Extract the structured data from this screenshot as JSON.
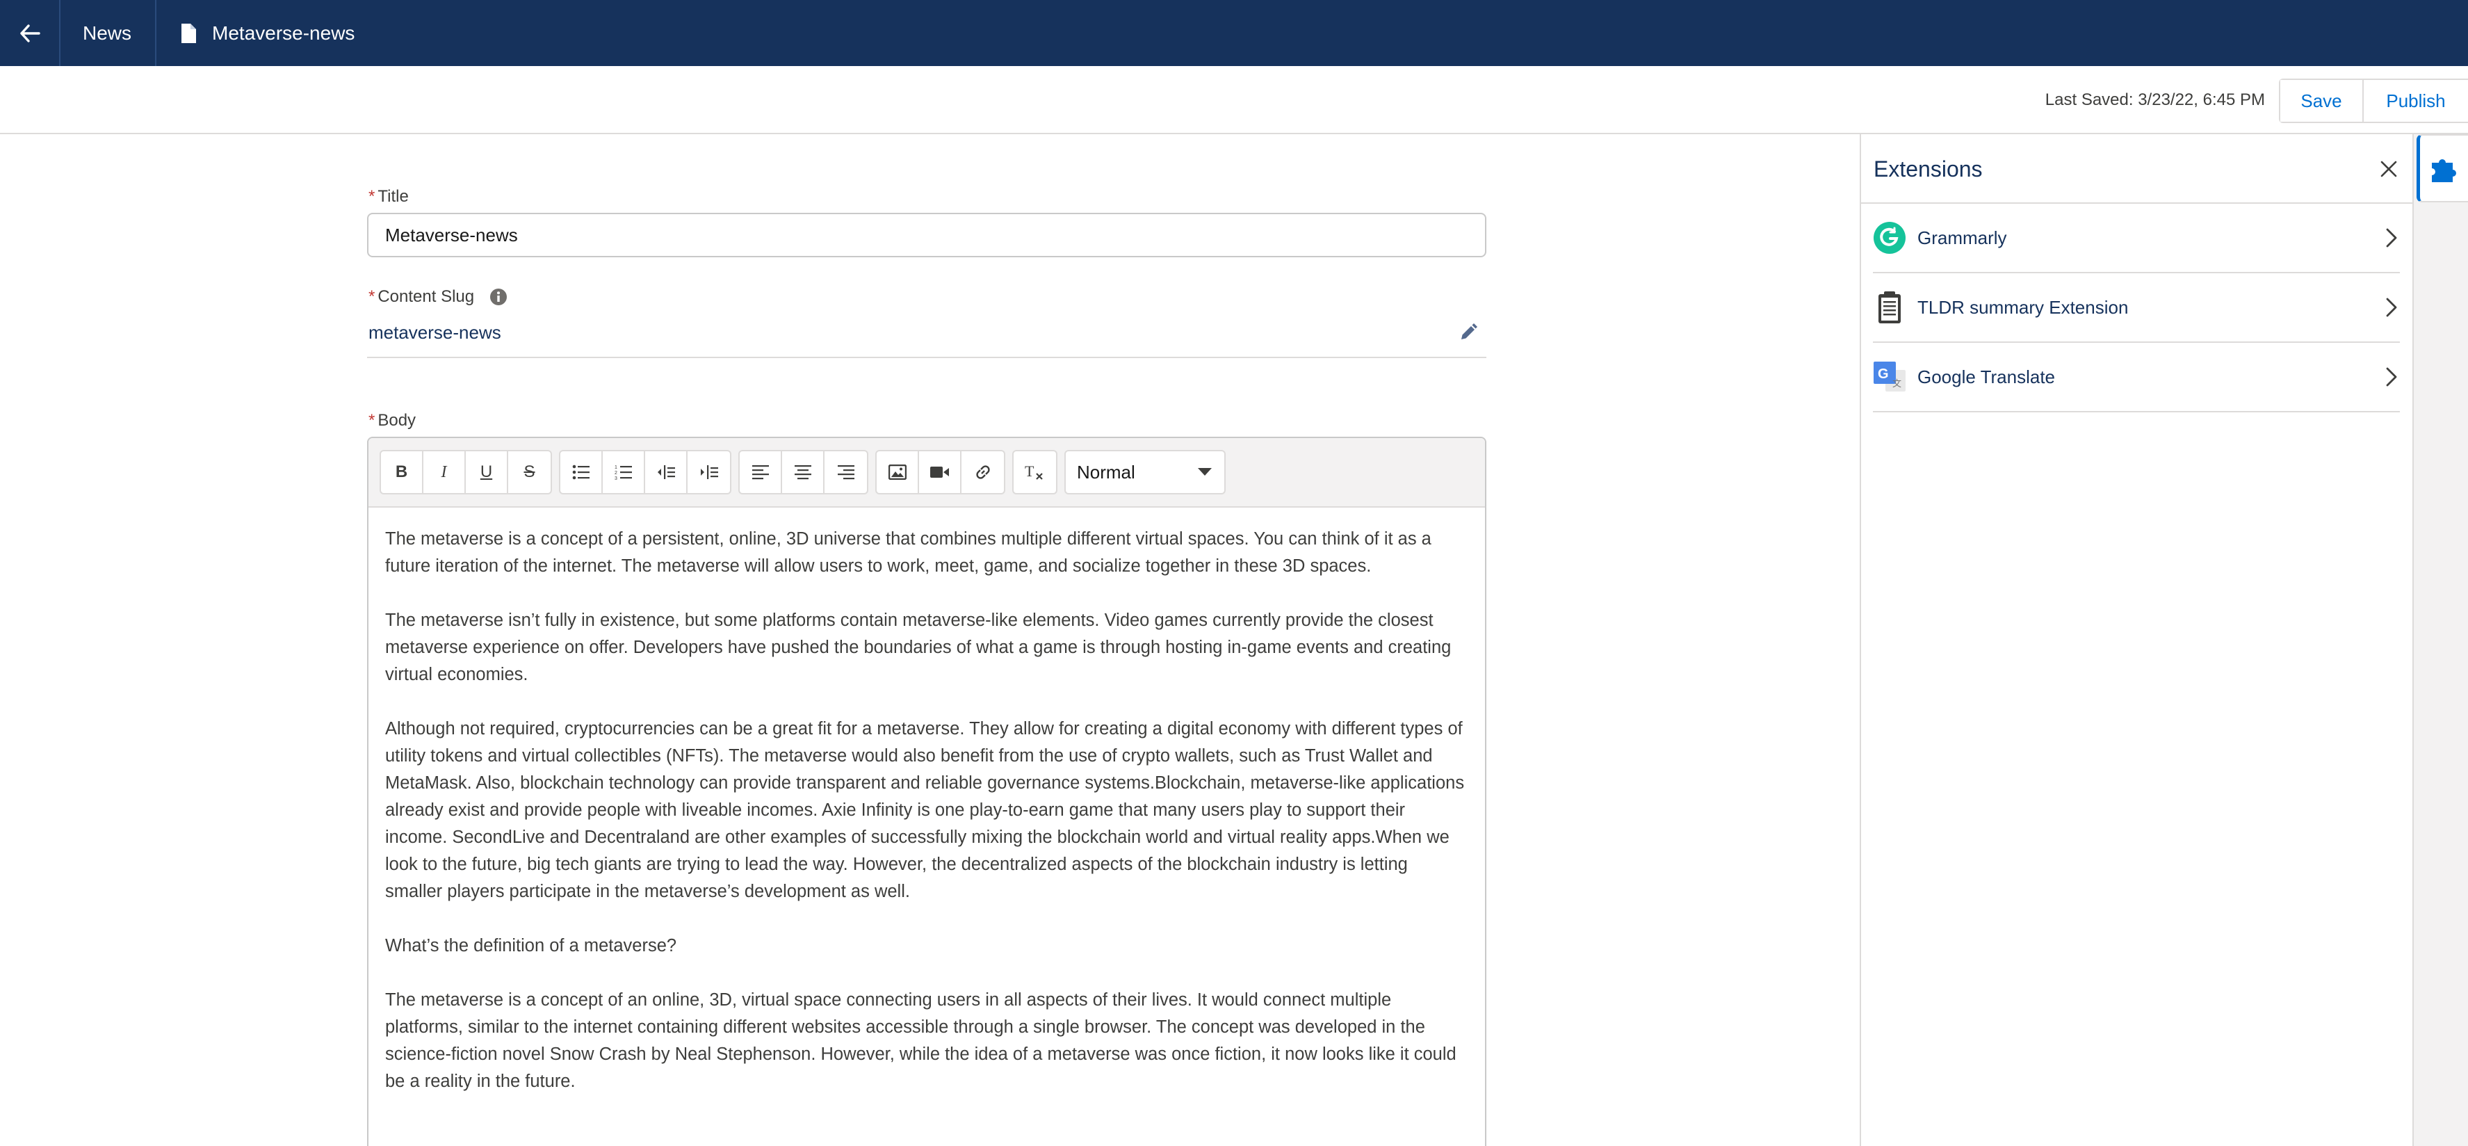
{
  "nav": {
    "back_icon": "arrow-left-icon",
    "breadcrumb_section": "News",
    "document_icon": "document-icon",
    "document_title": "Metaverse-news"
  },
  "actions": {
    "last_saved": "Last Saved: 3/23/22, 6:45 PM",
    "save_label": "Save",
    "publish_label": "Publish"
  },
  "form": {
    "title_label": "Title",
    "title_value": "Metaverse-news",
    "slug_label": "Content Slug",
    "slug_value": "metaverse-news",
    "body_label": "Body",
    "required_marker": "*"
  },
  "toolbar": {
    "groups": [
      [
        "bold-icon",
        "italic-icon",
        "underline-icon",
        "strikethrough-icon"
      ],
      [
        "bulleted-list-icon",
        "numbered-list-icon",
        "outdent-icon",
        "indent-icon"
      ],
      [
        "align-left-icon",
        "align-center-icon",
        "align-right-icon"
      ],
      [
        "image-icon",
        "video-icon",
        "link-icon"
      ],
      [
        "clear-formatting-icon"
      ]
    ],
    "format_select": "Normal"
  },
  "body": {
    "paragraphs": [
      "The metaverse is a concept of a persistent, online, 3D universe that combines multiple different virtual spaces. You can think of it as a future iteration of the internet. The metaverse will allow users to work, meet, game, and socialize together in these 3D spaces.",
      "The metaverse isn’t fully in existence, but some platforms contain metaverse-like elements. Video games currently provide the closest metaverse experience on offer. Developers have pushed the boundaries of what a game is through hosting in-game events and creating virtual economies.",
      "Although not required, cryptocurrencies can be a great fit for a metaverse. They allow for creating a digital economy with different types of utility tokens and virtual collectibles (NFTs). The metaverse would also benefit from the use of crypto wallets, such as Trust Wallet and MetaMask. Also, blockchain technology can provide transparent and reliable governance systems.Blockchain, metaverse-like applications already exist and provide people with liveable incomes. Axie Infinity is one play-to-earn game that many users play to support their income. SecondLive and Decentraland are other examples of successfully mixing the blockchain world and virtual reality apps.When we look to the future, big tech giants are trying to lead the way. However, the decentralized aspects of the blockchain industry is letting smaller players participate in the metaverse’s development as well.",
      "What’s the definition of a metaverse?",
      "The metaverse is a concept of an online, 3D, virtual space connecting users in all aspects of their lives. It would connect multiple platforms, similar to the internet containing different websites accessible through a single browser. The concept was developed in the science-fiction novel Snow Crash by Neal Stephenson. However, while the idea of a metaverse was once fiction, it now looks like it could be a reality in the future."
    ]
  },
  "extensions": {
    "title": "Extensions",
    "items": [
      {
        "label": "Grammarly",
        "icon": "grammarly-icon"
      },
      {
        "label": "TLDR summary Extension",
        "icon": "clipboard-icon"
      },
      {
        "label": "Google Translate",
        "icon": "google-translate-icon"
      }
    ]
  },
  "colors": {
    "nav_bg": "#16325c",
    "accent": "#0070d2",
    "grammarly": "#15c39a",
    "required": "#c23934"
  }
}
